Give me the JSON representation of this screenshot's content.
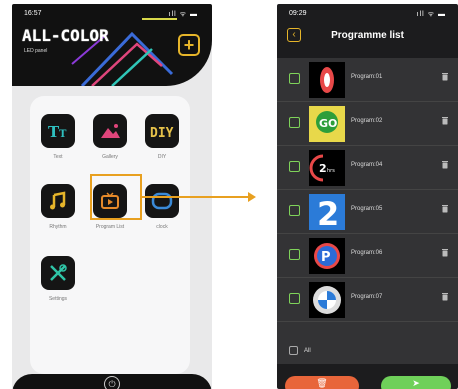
{
  "left_phone": {
    "status_bar": {
      "time": "16:57",
      "icons": "ıll ᯤ ▬"
    },
    "brand": {
      "title": "ALL-COLOR",
      "subtitle": "LED panel"
    },
    "add_button": {
      "icon": "plus-icon"
    },
    "apps": [
      {
        "label": "Text",
        "icon": "text-icon"
      },
      {
        "label": "Gallery",
        "icon": "image-icon"
      },
      {
        "label": "DIY",
        "icon": "diy-icon"
      },
      {
        "label": "Rhythm",
        "icon": "music-note-icon"
      },
      {
        "label": "Program List",
        "icon": "tv-icon"
      },
      {
        "label": "clock",
        "icon": "clock-icon"
      },
      {
        "label": "Settings",
        "icon": "tools-icon"
      }
    ],
    "footer": {
      "icon": "power-icon"
    }
  },
  "right_phone": {
    "status_bar": {
      "time": "09:29",
      "icons": "ıll ᯤ ▬"
    },
    "title": "Programme list",
    "programs": [
      {
        "name": "Program:01",
        "thumb": "red-disc"
      },
      {
        "name": "Program:02",
        "thumb": "go-sign"
      },
      {
        "name": "Program:04",
        "thumb": "2hrs-sign"
      },
      {
        "name": "Program:05",
        "thumb": "number-2"
      },
      {
        "name": "Program:06",
        "thumb": "parking-sign"
      },
      {
        "name": "Program:07",
        "thumb": "bmw-logo"
      }
    ],
    "all_label": "All",
    "colors": {
      "accent": "#e6b52a",
      "checkbox": "#7fd35a",
      "delete": "#e8653a",
      "send": "#6fd05a"
    }
  }
}
